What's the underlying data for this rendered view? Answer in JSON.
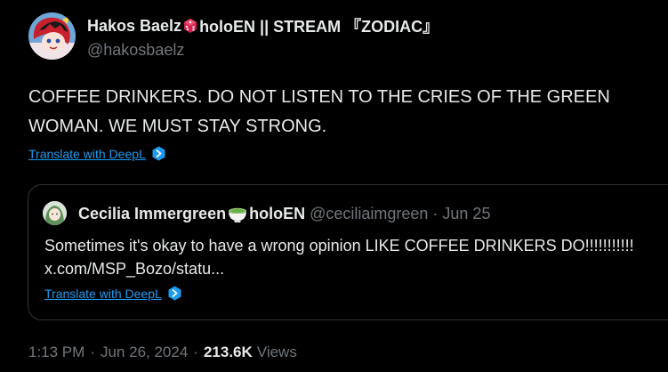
{
  "tweet": {
    "author": {
      "name_part1": "Hakos Baelz",
      "name_part2": "holoEN || STREAM 『ZODIAC』",
      "handle": "@hakosbaelz",
      "dice_icon": "dice-icon"
    },
    "text": "COFFEE DRINKERS. DO NOT LISTEN TO THE CRIES OF THE GREEN WOMAN. WE MUST STAY STRONG.",
    "translate_label": "Translate with DeepL",
    "quote": {
      "name_part1": "Cecilia Immergreen",
      "name_part2": "holoEN",
      "handle": "@ceciliaimgreen",
      "separator": "·",
      "date": "Jun 25",
      "text": "Sometimes it's okay to have a wrong opinion LIKE COFFEE DRINKERS DO!!!!!!!!!!! x.com/MSP_Bozo/statu...",
      "translate_label": "Translate with DeepL"
    },
    "meta": {
      "time": "1:13 PM",
      "sep1": "·",
      "date": "Jun 26, 2024",
      "sep2": "·",
      "views_count": "213.6K",
      "views_label": "Views"
    }
  },
  "colors": {
    "background": "#000000",
    "text_primary": "#e7e9ea",
    "text_secondary": "#71767b",
    "link": "#1d9bf0",
    "border": "#2f3336",
    "dice_red": "#d6204e"
  }
}
